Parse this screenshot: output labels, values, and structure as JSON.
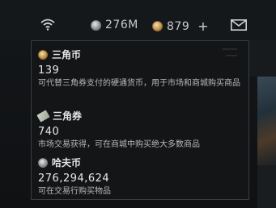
{
  "topbar": {
    "hafu_amount": "276M",
    "sanjiao_amount": "879",
    "plus": "+"
  },
  "tooltip": {
    "items": [
      {
        "title": "三角币",
        "value": "139",
        "desc": "可代替三角券支付的硬通货币，用于市场和商城购买商品"
      },
      {
        "title": "三角券",
        "value": "740",
        "desc": "市场交易获得，可在商城中购买绝大多数商品"
      },
      {
        "title": "哈夫币",
        "value": "276,294,624",
        "desc": "可在交易行购买物品"
      }
    ]
  },
  "icons": {
    "wifi": "wifi-icon",
    "hafu": "silver-coin-icon",
    "sanjiao": "gold-coin-icon",
    "mail": "mail-icon",
    "ticket": "ticket-icon"
  }
}
